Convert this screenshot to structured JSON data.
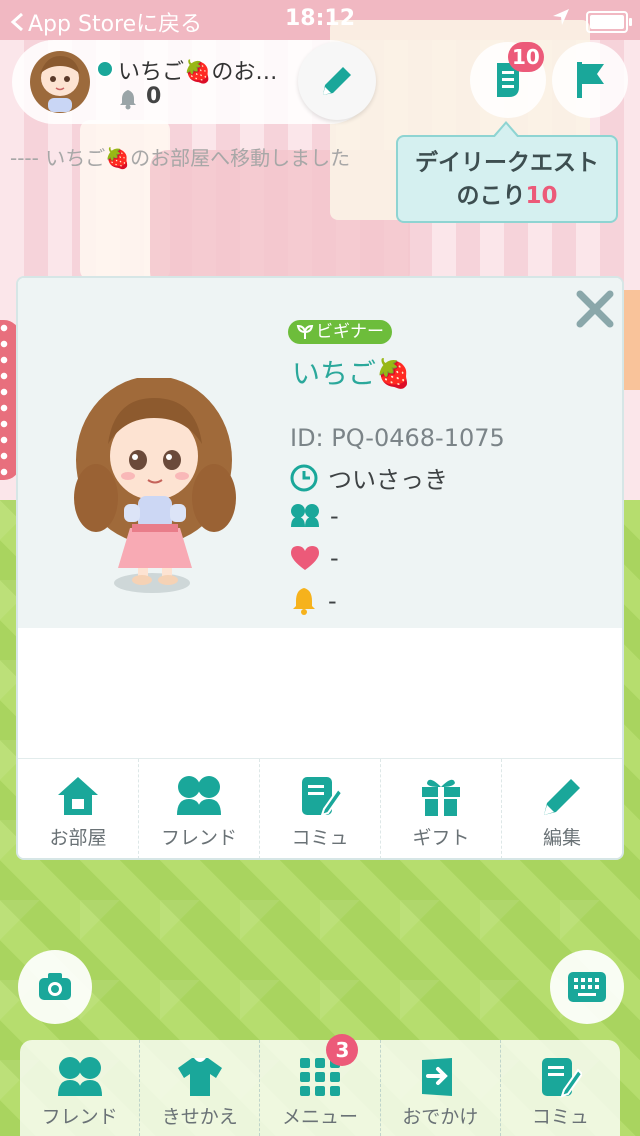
{
  "status_bar": {
    "back_label": "App Storeに戻る",
    "time": "18:12"
  },
  "user": {
    "name": "いちご🍓のお…",
    "bell_count": "0"
  },
  "quest": {
    "badge": "10",
    "tooltip_line1": "デイリークエスト",
    "tooltip_prefix": "のこり",
    "tooltip_count": "10"
  },
  "system_message": "---- いちご🍓のお部屋へ移動しました",
  "profile": {
    "rank": "ビギナー",
    "name": "いちご🍓",
    "id": "ID: PQ-0468-1075",
    "last_login": "ついさっき",
    "friends": "-",
    "likes": "-",
    "bells": "-"
  },
  "card_actions": [
    {
      "label": "お部屋",
      "icon": "house-icon"
    },
    {
      "label": "フレンド",
      "icon": "friends-icon"
    },
    {
      "label": "コミュ",
      "icon": "community-icon"
    },
    {
      "label": "ギフト",
      "icon": "gift-icon"
    },
    {
      "label": "編集",
      "icon": "pencil-icon"
    }
  ],
  "bottom_nav": [
    {
      "label": "フレンド",
      "icon": "friends-icon"
    },
    {
      "label": "きせかえ",
      "icon": "shirt-icon"
    },
    {
      "label": "メニュー",
      "icon": "grid-icon",
      "badge": "3"
    },
    {
      "label": "おでかけ",
      "icon": "door-exit-icon"
    },
    {
      "label": "コミュ",
      "icon": "community-icon"
    }
  ],
  "colors": {
    "accent": "#1aa79a",
    "badge": "#ec5a79",
    "beginner": "#6dbd3b",
    "name": "#2ba89b"
  }
}
